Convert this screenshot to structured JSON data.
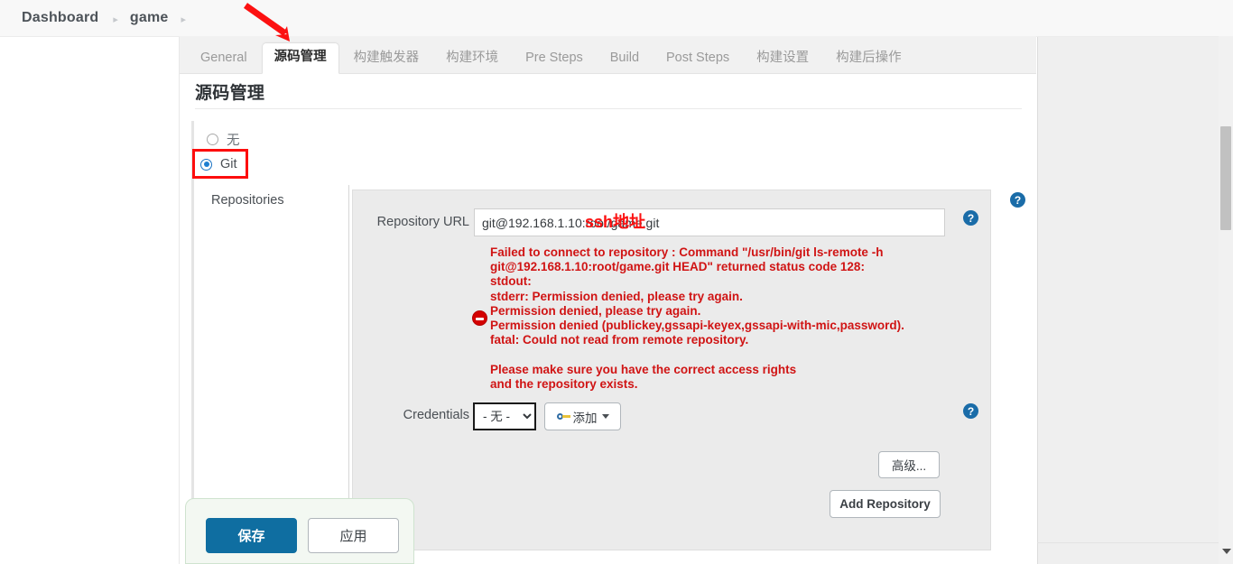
{
  "breadcrumb": {
    "items": [
      "Dashboard",
      "game"
    ],
    "separator": "▸"
  },
  "tabs": [
    {
      "label": "General",
      "active": false
    },
    {
      "label": "源码管理",
      "active": true
    },
    {
      "label": "构建触发器",
      "active": false
    },
    {
      "label": "构建环境",
      "active": false
    },
    {
      "label": "Pre Steps",
      "active": false
    },
    {
      "label": "Build",
      "active": false
    },
    {
      "label": "Post Steps",
      "active": false
    },
    {
      "label": "构建设置",
      "active": false
    },
    {
      "label": "构建后操作",
      "active": false
    }
  ],
  "section": {
    "title": "源码管理",
    "scm_options": [
      {
        "label": "无",
        "selected": false
      },
      {
        "label": "Git",
        "selected": true
      }
    ]
  },
  "git": {
    "repositories_label": "Repositories",
    "repository_url_label": "Repository URL",
    "repository_url_value": "git@192.168.1.10:root/game.git",
    "credentials_label": "Credentials",
    "credentials_value": "- 无 -",
    "credentials_options": [
      "- 无 -"
    ],
    "add_credentials_label": "添加",
    "advanced_label": "高级...",
    "add_repository_label": "Add Repository",
    "help_symbol": "?",
    "error_message": "Failed to connect to repository : Command \"/usr/bin/git ls-remote -h git@192.168.1.10:root/game.git HEAD\" returned status code 128:\nstdout:\nstderr: Permission denied, please try again.\nPermission denied, please try again.\nPermission denied (publickey,gssapi-keyex,gssapi-with-mic,password).\nfatal: Could not read from remote repository.\n\nPlease make sure you have the correct access rights\nand the repository exists."
  },
  "annotations": {
    "ssh_note": "ssh地址",
    "arrow_color": "#fc1111",
    "highlight_color": "#fd0d0d"
  },
  "footer": {
    "save_label": "保存",
    "apply_label": "应用"
  },
  "colors": {
    "accent_blue": "#1a6ca8",
    "save_blue": "#0f6ea1",
    "error_red": "#d01414",
    "annotation_red": "#fc1111"
  }
}
